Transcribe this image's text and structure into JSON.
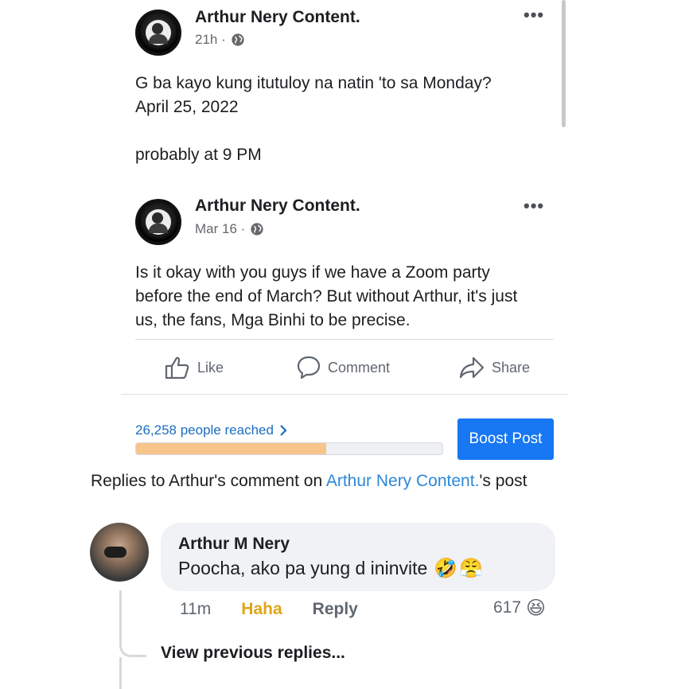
{
  "posts": [
    {
      "author": "Arthur Nery Content.",
      "time": "21h ·",
      "text_lines": [
        "G ba kayo kung itutuloy na natin 'to sa Monday?",
        "April 25, 2022",
        "",
        "probably at 9 PM"
      ]
    },
    {
      "author": "Arthur Nery Content.",
      "time": "Mar 16 ·",
      "text_lines": [
        "Is it okay with you guys if we have a Zoom party",
        "before the end of March? But without Arthur, it's just",
        "us, the fans, Mga Binhi to be precise."
      ]
    }
  ],
  "more_label": "•••",
  "actions": {
    "like": "Like",
    "comment": "Comment",
    "share": "Share"
  },
  "insights": {
    "reached": "26,258 people reached",
    "progress": 0.62,
    "boost_label": "Boost Post"
  },
  "replies_header": {
    "prefix": "Replies to Arthur's comment on ",
    "page": "Arthur Nery Content.",
    "suffix_link": "'s post"
  },
  "comment": {
    "author": "Arthur M Nery",
    "text": "Poocha, ako pa yung d ininvite",
    "emojis": [
      "🤣",
      "😤"
    ],
    "time": "11m",
    "haha_label": "Haha",
    "reply_label": "Reply",
    "reaction_count": "617",
    "reaction_emoji": "😆"
  },
  "view_previous": "View previous replies...",
  "colors": {
    "accent": "#1877f2",
    "link": "#2d88d8",
    "haha": "#e0a516",
    "progress_fill": "#f7c58c"
  }
}
